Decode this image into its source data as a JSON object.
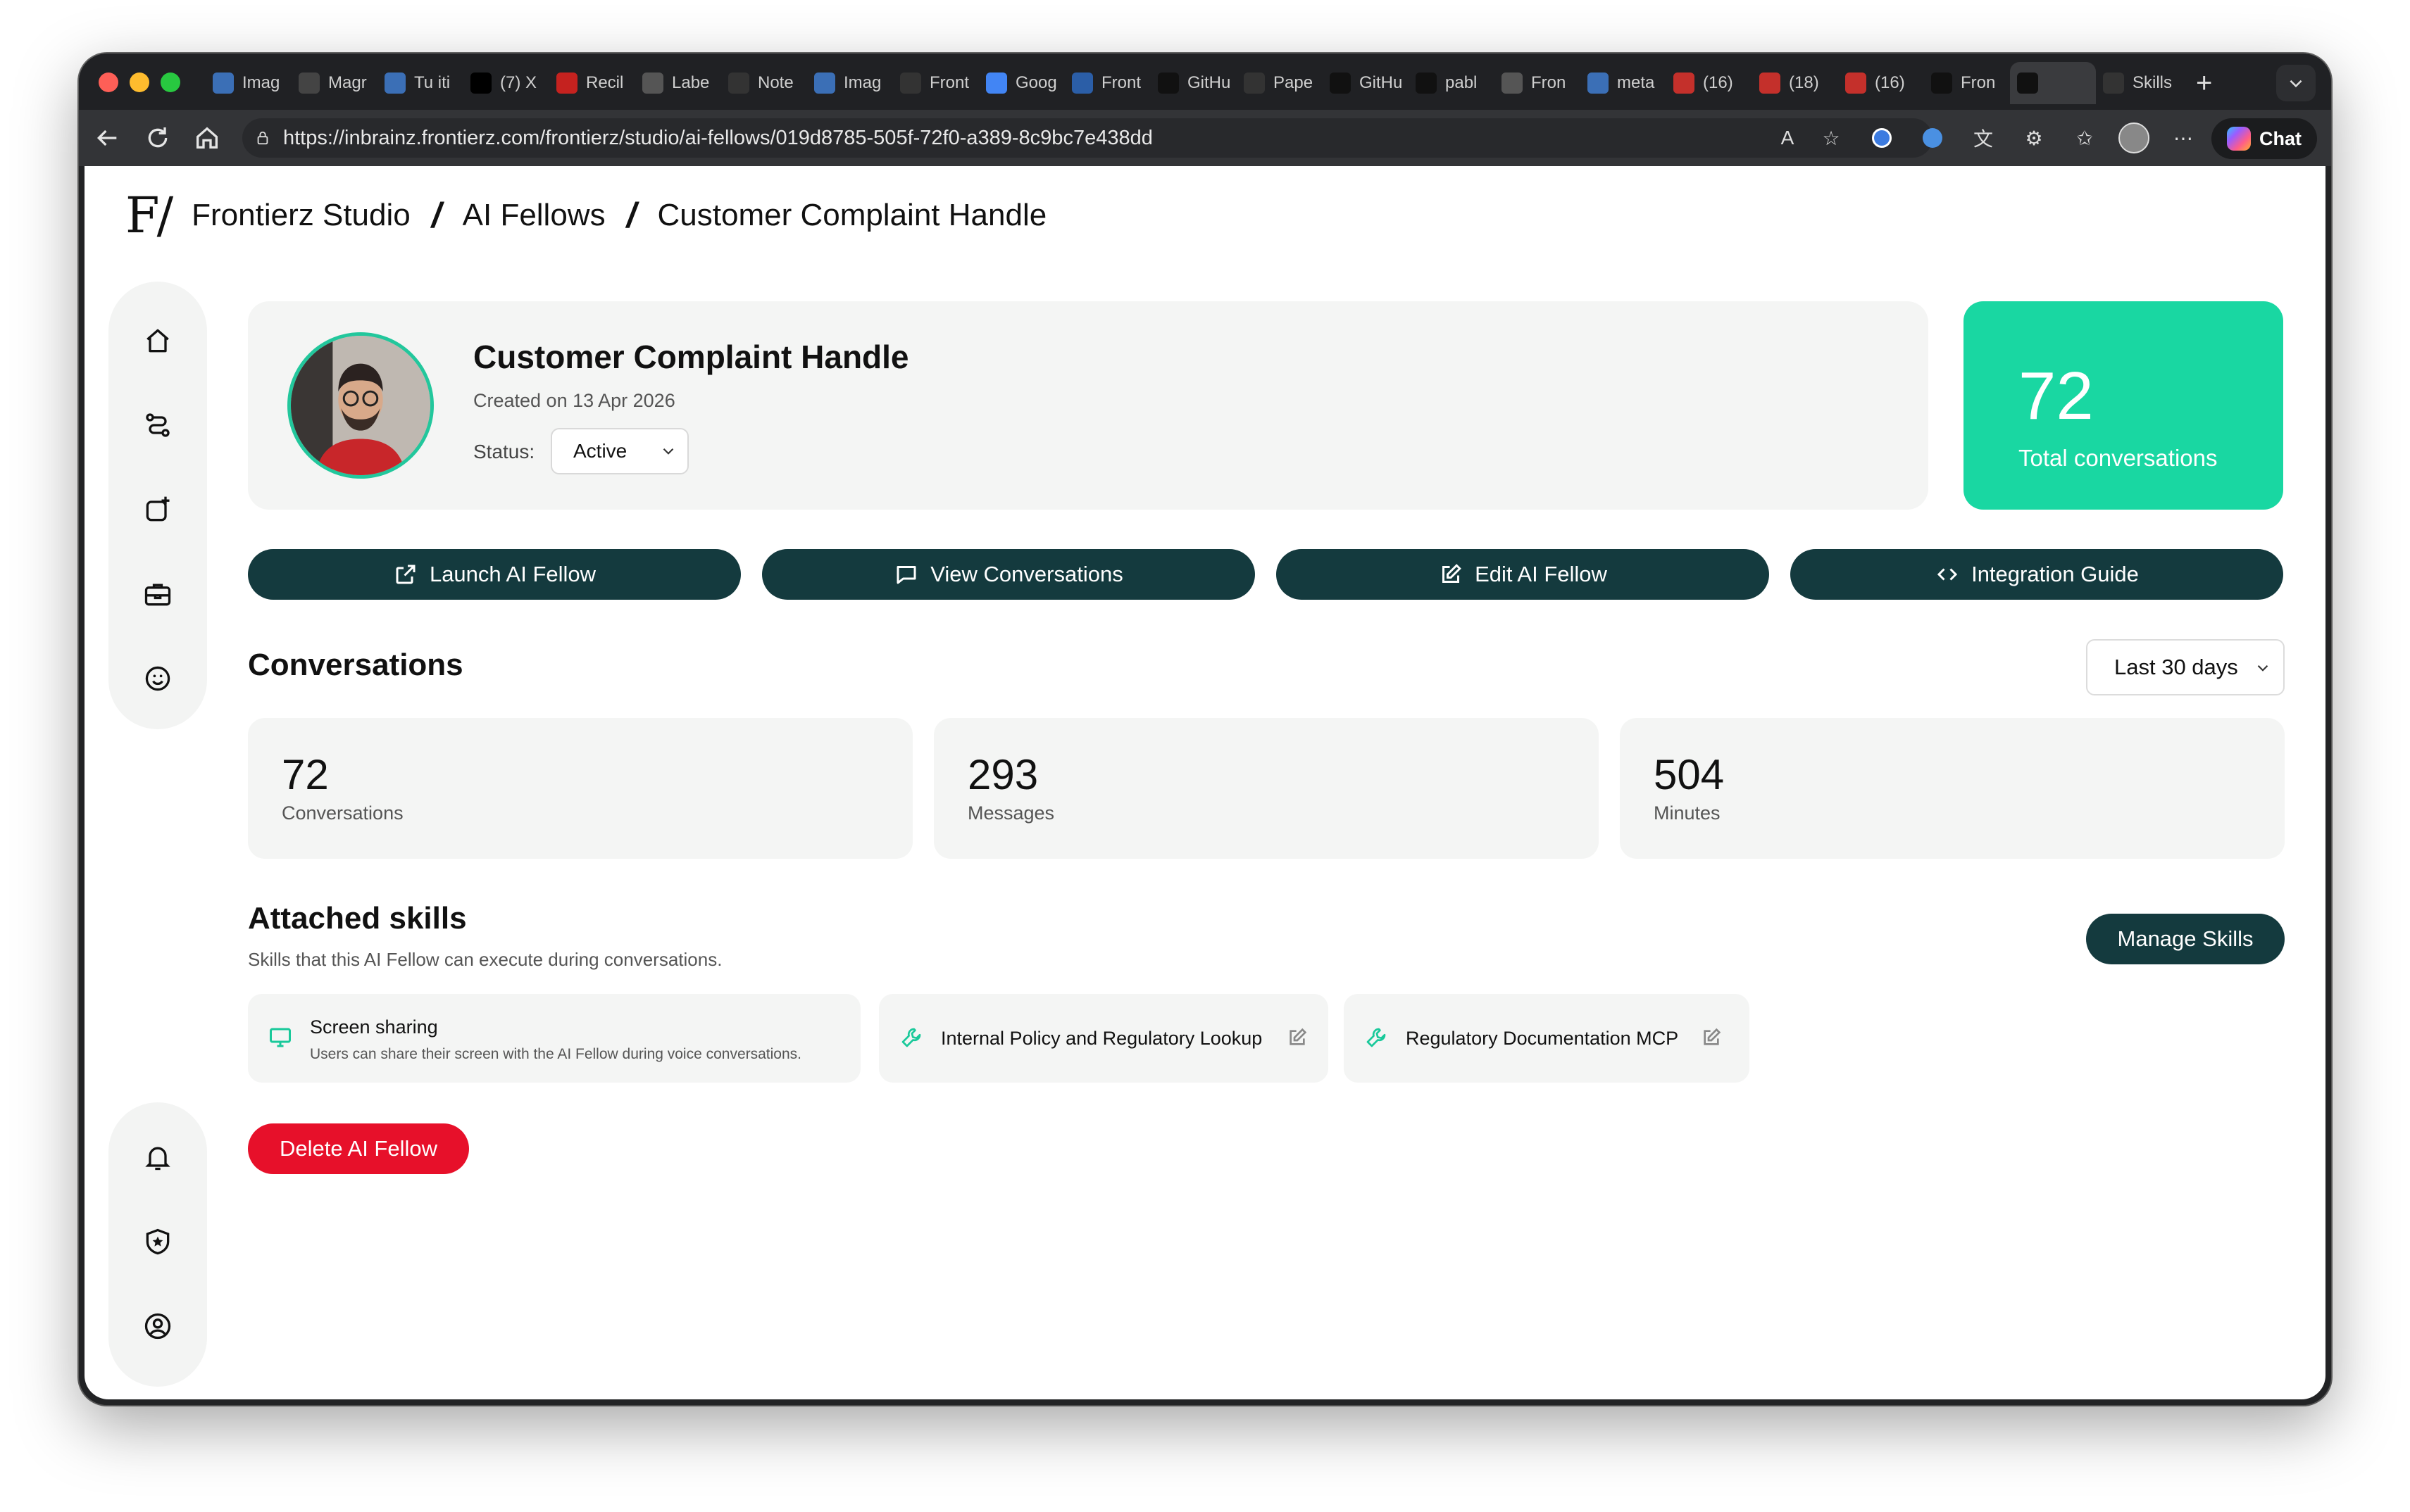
{
  "browser": {
    "tabs": [
      {
        "label": "Imag",
        "icon": "doc-icon",
        "color": "#3b6fb6"
      },
      {
        "label": "Magr",
        "icon": "triangle-icon",
        "color": "#444"
      },
      {
        "label": "Tu iti",
        "icon": "frontierz-icon",
        "color": "#3b6fb6"
      },
      {
        "label": "(7) X",
        "icon": "x-icon",
        "color": "#000"
      },
      {
        "label": "Recil",
        "icon": "gmail-icon",
        "color": "#c5221f"
      },
      {
        "label": "Labe",
        "icon": "label-icon",
        "color": "#555"
      },
      {
        "label": "Note",
        "icon": "note-icon",
        "color": "#333"
      },
      {
        "label": "Imag",
        "icon": "doc-icon",
        "color": "#3b6fb6"
      },
      {
        "label": "Front",
        "icon": "frontierz-icon",
        "color": "#333"
      },
      {
        "label": "Goog",
        "icon": "gemini-icon",
        "color": "#4285f4"
      },
      {
        "label": "Front",
        "icon": "frontierz-icon",
        "color": "#2b5ea7"
      },
      {
        "label": "GitHu",
        "icon": "github-icon",
        "color": "#111"
      },
      {
        "label": "Pape",
        "icon": "paper-icon",
        "color": "#333"
      },
      {
        "label": "GitHu",
        "icon": "github-icon",
        "color": "#111"
      },
      {
        "label": "pabl",
        "icon": "github-icon",
        "color": "#111"
      },
      {
        "label": "Fron",
        "icon": "close-x-icon",
        "color": "#555"
      },
      {
        "label": "meta",
        "icon": "check-icon",
        "color": "#3b6fb6"
      },
      {
        "label": "(16)",
        "icon": "youtube-icon",
        "color": "#c4302b"
      },
      {
        "label": "(18)",
        "icon": "youtube-icon",
        "color": "#c4302b"
      },
      {
        "label": "(16)",
        "icon": "youtube-icon",
        "color": "#c4302b"
      },
      {
        "label": "Fron",
        "icon": "frontierz-icon",
        "color": "#111"
      },
      {
        "label": "",
        "icon": "frontierz-icon",
        "color": "#111",
        "active": true
      },
      {
        "label": "Skills",
        "icon": "frontierz-icon",
        "color": "#333"
      }
    ],
    "new_tab": "+",
    "url": "https://inbrainz.frontierz.com/frontierz/studio/ai-fellows/019d8785-505f-72f0-a389-8c9bc7e438dd",
    "chat_label": "Chat"
  },
  "breadcrumb": {
    "logo": "F/",
    "items": [
      "Frontierz Studio",
      "AI Fellows",
      "Customer Complaint Handle"
    ],
    "separator": "/"
  },
  "profile": {
    "name": "Customer Complaint Handle",
    "created": "Created on 13 Apr 2026",
    "status_label": "Status:",
    "status_value": "Active"
  },
  "total": {
    "value": "72",
    "label": "Total conversations"
  },
  "actions": {
    "launch": "Launch AI Fellow",
    "view": "View Conversations",
    "edit": "Edit AI Fellow",
    "guide": "Integration Guide"
  },
  "conversations": {
    "title": "Conversations",
    "range": "Last 30 days",
    "stats": [
      {
        "value": "72",
        "label": "Conversations"
      },
      {
        "value": "293",
        "label": "Messages"
      },
      {
        "value": "504",
        "label": "Minutes"
      }
    ]
  },
  "skills": {
    "title": "Attached skills",
    "subtitle": "Skills that this AI Fellow can execute during conversations.",
    "manage": "Manage Skills",
    "items": [
      {
        "name": "Screen sharing",
        "desc": "Users can share their screen with the AI Fellow during voice conversations."
      },
      {
        "name": "Internal Policy and Regulatory Lookup"
      },
      {
        "name": "Regulatory Documentation MCP"
      }
    ]
  },
  "danger": {
    "delete": "Delete AI Fellow"
  },
  "colors": {
    "accent": "#19d7a2",
    "dark_button": "#143a3e",
    "danger": "#e7102a"
  }
}
